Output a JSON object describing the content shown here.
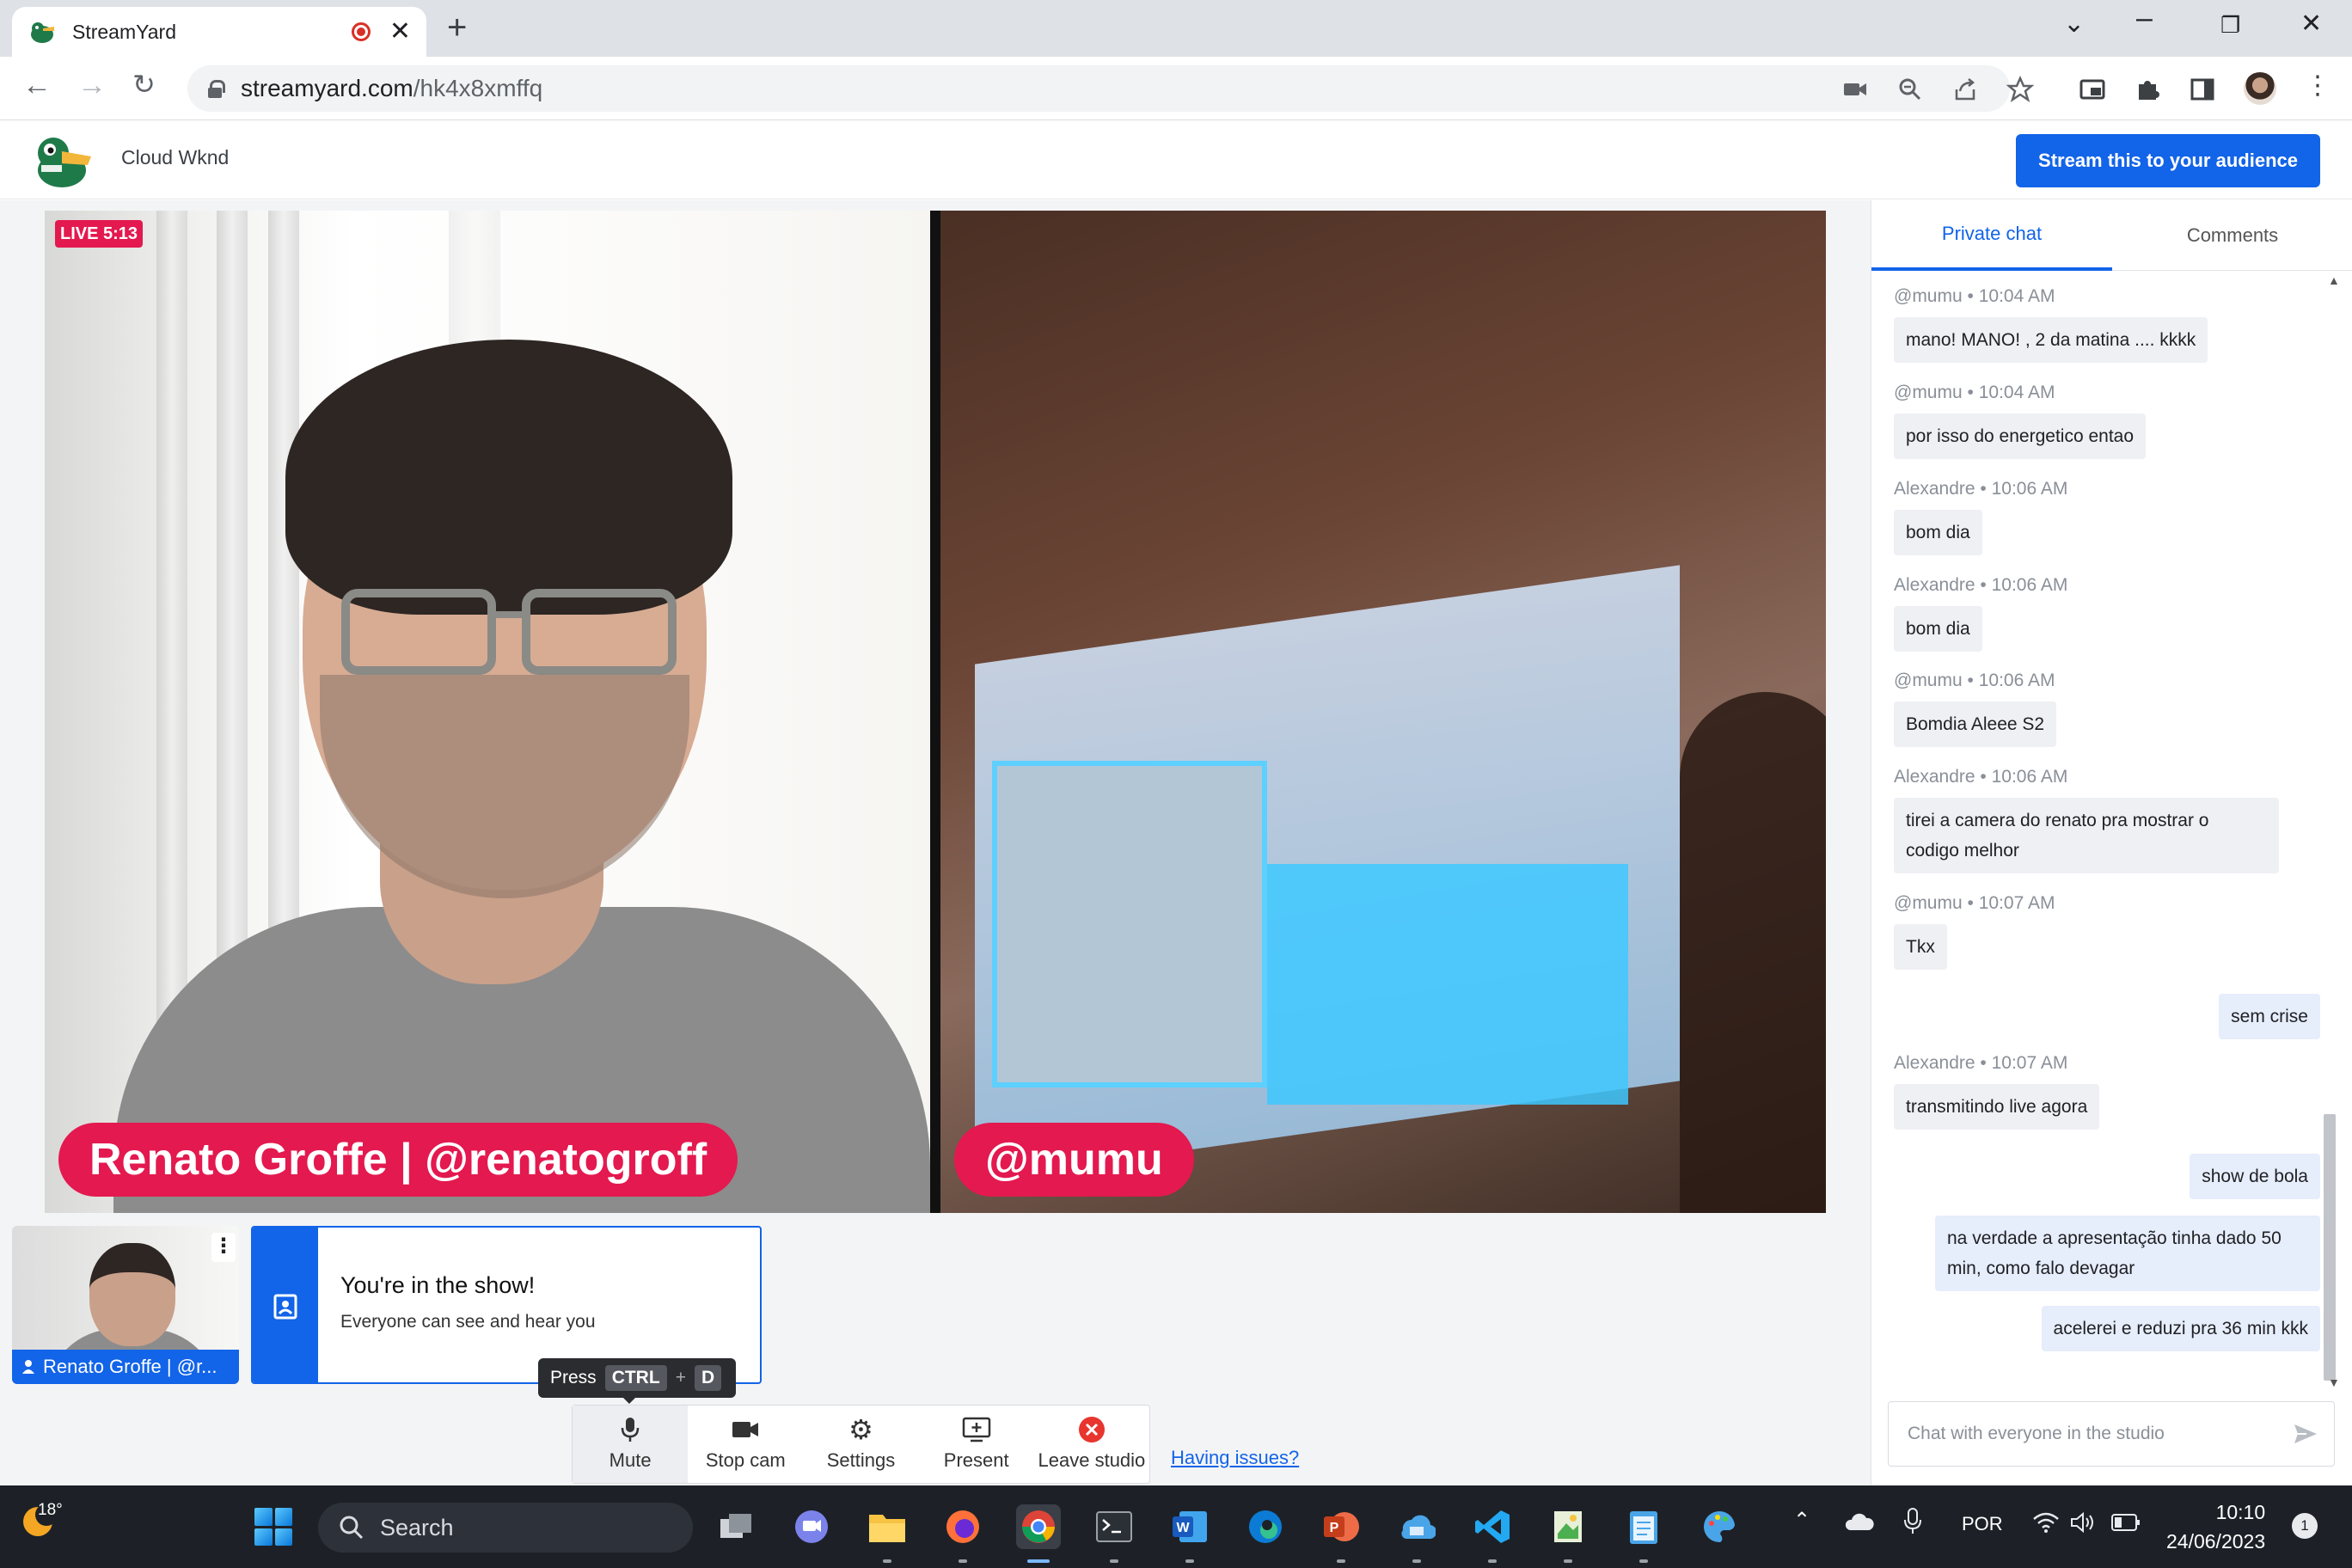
{
  "browser": {
    "tab_title": "StreamYard",
    "url_host": "streamyard.com",
    "url_path": "/hk4x8xmffq"
  },
  "app": {
    "brand_name": "Cloud Wknd",
    "stream_button": "Stream this to your audience"
  },
  "stage": {
    "live_badge": "LIVE 5:13",
    "participants": [
      {
        "name_banner": "Renato Groffe | @renatogroff"
      },
      {
        "name_banner": "@mumu"
      }
    ]
  },
  "backstage": {
    "thumbnail_label": "Renato Groffe | @r...",
    "inshow_title": "You're in the show!",
    "inshow_subtitle": "Everyone can see and hear you"
  },
  "tooltip": {
    "press": "Press",
    "key1": "CTRL",
    "plus": "+",
    "key2": "D"
  },
  "controls": [
    {
      "label": "Mute",
      "icon": "mic-icon"
    },
    {
      "label": "Stop cam",
      "icon": "camera-icon"
    },
    {
      "label": "Settings",
      "icon": "gear-icon"
    },
    {
      "label": "Present",
      "icon": "present-icon"
    },
    {
      "label": "Leave studio",
      "icon": "leave-icon"
    }
  ],
  "having_issues": "Having issues?",
  "chat": {
    "tabs": [
      "Private chat",
      "Comments"
    ],
    "messages": [
      {
        "author": "@mumu",
        "time": "10:04 AM",
        "text": "mano! MANO! , 2 da matina .... kkkk"
      },
      {
        "author": "@mumu",
        "time": "10:04 AM",
        "text": "por isso do energetico entao"
      },
      {
        "author": "Alexandre",
        "time": "10:06 AM",
        "text": "bom dia"
      },
      {
        "author": "Alexandre",
        "time": "10:06 AM",
        "text": "bom dia"
      },
      {
        "author": "@mumu",
        "time": "10:06 AM",
        "text": "Bomdia Aleee S2"
      },
      {
        "author": "Alexandre",
        "time": "10:06 AM",
        "text": "tirei a camera do renato pra mostrar o codigo melhor"
      },
      {
        "author": "@mumu",
        "time": "10:07 AM",
        "text": "Tkx"
      },
      {
        "author": "Alexandre",
        "time": "10:07 AM",
        "text": "transmitindo live agora"
      }
    ],
    "own_messages": [
      "sem crise",
      "show de bola",
      "na verdade a apresentação tinha dado 50 min, como falo devagar",
      "acelerei e reduzi pra 36 min kkk"
    ],
    "separator": "•",
    "input_placeholder": "Chat with everyone in the studio"
  },
  "taskbar": {
    "temperature": "18°",
    "search_label": "Search",
    "language": "POR",
    "time": "10:10",
    "date": "24/06/2023",
    "notification_count": "1"
  },
  "colors": {
    "accent": "#1264e8",
    "banner": "#e3194f"
  }
}
